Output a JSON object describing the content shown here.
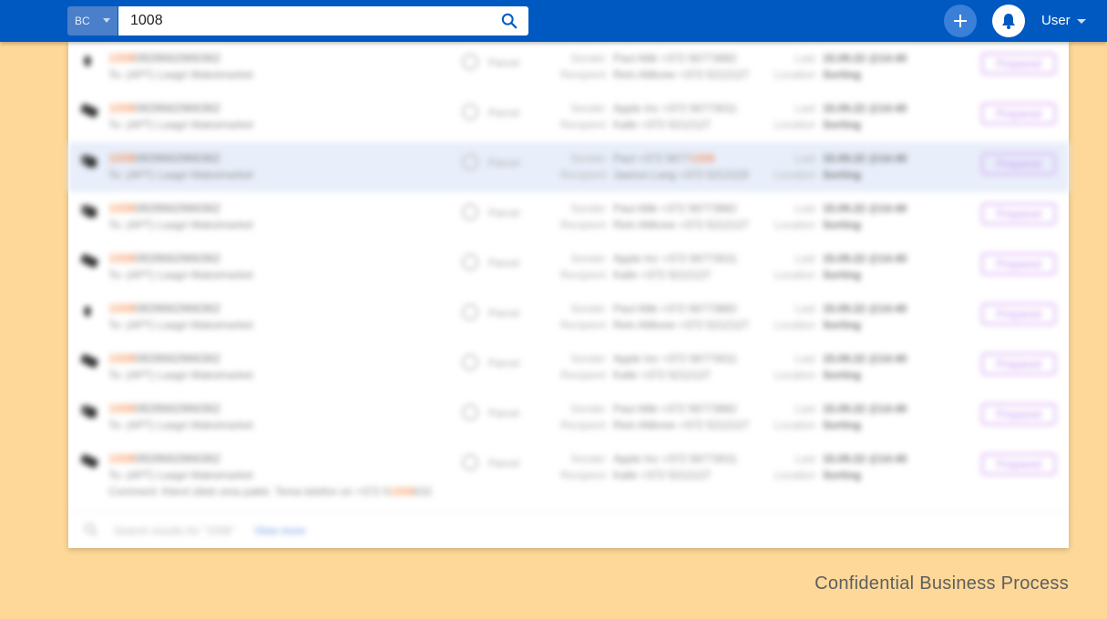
{
  "header": {
    "scope_label": "BC",
    "search_value": "1008",
    "user_label": "User"
  },
  "results": [
    {
      "icon": "parcel-single",
      "id_prefix": "1008",
      "id_rest": "0828662966362",
      "to": "To: (APT) Laagri Maksimarket",
      "kind": "Parcel",
      "sender_label": "Sender",
      "sender_pre": "Paul Allik +372 56773882",
      "sender_hl": "",
      "recipient_label": "Recipient",
      "recipient": "Rein Allikvee +372 5212127",
      "last_label": "Last",
      "last_value": "15.09.22 @14:40",
      "location_label": "Location",
      "location": "Sorting",
      "status": "Prepared",
      "selected": false
    },
    {
      "icon": "parcel-stack",
      "id_prefix": "1008",
      "id_rest": "0828662966362",
      "to": "To: (APT) Laagri Maksimarket",
      "kind": "Parcel",
      "sender_label": "Sender",
      "sender_pre": "Apple Inc +372 56773011",
      "sender_hl": "",
      "recipient_label": "Recipient",
      "recipient": "Kalle +372 5212127",
      "last_label": "Last",
      "last_value": "15.09.22 @14:40",
      "location_label": "Location",
      "location": "Sorting",
      "status": "Prepared",
      "selected": false
    },
    {
      "icon": "parcel-multi",
      "id_prefix": "1008",
      "id_rest": "0828662966362",
      "to": "To: (APT) Laagri Maksimarket",
      "kind": "Parcel",
      "sender_label": "Sender",
      "sender_pre": "Paul +372 5677",
      "sender_hl": "1008",
      "recipient_label": "Recipient",
      "recipient": "Jaanus Lang +372 5212119",
      "last_label": "Last",
      "last_value": "15.09.22 @14:40",
      "location_label": "Location",
      "location": "Sorting",
      "status": "Prepared",
      "selected": true
    },
    {
      "icon": "parcel-multi",
      "id_prefix": "1008",
      "id_rest": "0828662966362",
      "to": "To: (APT) Laagri Maksimarket",
      "kind": "Parcel",
      "sender_label": "Sender",
      "sender_pre": "Paul Allik +372 56773882",
      "sender_hl": "",
      "recipient_label": "Recipient",
      "recipient": "Rein Allikvee +372 5212127",
      "last_label": "Last",
      "last_value": "15.09.22 @14:40",
      "location_label": "Location",
      "location": "Sorting",
      "status": "Prepared",
      "selected": false
    },
    {
      "icon": "parcel-stack",
      "id_prefix": "1008",
      "id_rest": "0828662966362",
      "to": "To: (APT) Laagri Maksimarket",
      "kind": "Parcel",
      "sender_label": "Sender",
      "sender_pre": "Apple Inc +372 56773011",
      "sender_hl": "",
      "recipient_label": "Recipient",
      "recipient": "Kalle +372 5212127",
      "last_label": "Last",
      "last_value": "15.09.22 @14:40",
      "location_label": "Location",
      "location": "Sorting",
      "status": "Prepared",
      "selected": false
    },
    {
      "icon": "parcel-single",
      "id_prefix": "1008",
      "id_rest": "0828662966362",
      "to": "To: (APT) Laagri Maksimarket",
      "kind": "Parcel",
      "sender_label": "Sender",
      "sender_pre": "Paul Allik +372 56773882",
      "sender_hl": "",
      "recipient_label": "Recipient",
      "recipient": "Rein Allikvee +372 5212127",
      "last_label": "Last",
      "last_value": "15.09.22 @14:40",
      "location_label": "Location",
      "location": "Sorting",
      "status": "Prepared",
      "selected": false
    },
    {
      "icon": "parcel-stack",
      "id_prefix": "1008",
      "id_rest": "0828662966362",
      "to": "To: (APT) Laagri Maksimarket",
      "kind": "Parcel",
      "sender_label": "Sender",
      "sender_pre": "Apple Inc +372 56773011",
      "sender_hl": "",
      "recipient_label": "Recipient",
      "recipient": "Kalle +372 5212127",
      "last_label": "Last",
      "last_value": "15.09.22 @14:40",
      "location_label": "Location",
      "location": "Sorting",
      "status": "Prepared",
      "selected": false
    },
    {
      "icon": "parcel-multi",
      "id_prefix": "1008",
      "id_rest": "0828662966362",
      "to": "To: (APT) Laagri Maksimarket",
      "kind": "Parcel",
      "sender_label": "Sender",
      "sender_pre": "Paul Allik +372 56773882",
      "sender_hl": "",
      "recipient_label": "Recipient",
      "recipient": "Rein Allikvee +372 5212127",
      "last_label": "Last",
      "last_value": "15.09.22 @14:40",
      "location_label": "Location",
      "location": "Sorting",
      "status": "Prepared",
      "selected": false
    },
    {
      "icon": "parcel-stack",
      "id_prefix": "1008",
      "id_rest": "0828662966362",
      "to": "To: (APT) Laagri Maksimarket",
      "kind": "Parcel",
      "sender_label": "Sender",
      "sender_pre": "Apple Inc +372 56773011",
      "sender_hl": "",
      "recipient_label": "Recipient",
      "recipient": "Kalle +372 5212127",
      "last_label": "Last",
      "last_value": "15.09.22 @14:40",
      "location_label": "Location",
      "location": "Sorting",
      "status": "Prepared",
      "selected": false,
      "comment_label": "Comment:",
      "comment_text": "Klient ütleb oma pakki. Tema telefon on +372 5",
      "comment_hl": "1008",
      "comment_rest": "632"
    }
  ],
  "footer": {
    "text": "Search results for \"1008\"",
    "more": "View more"
  },
  "watermark": "Confidential Business Process",
  "colors": {
    "topbar": "#0059c0",
    "background": "#fdd898",
    "highlight": "#f4742a",
    "status_purple": "#c48ef0",
    "selected_row": "#e8eefa"
  }
}
